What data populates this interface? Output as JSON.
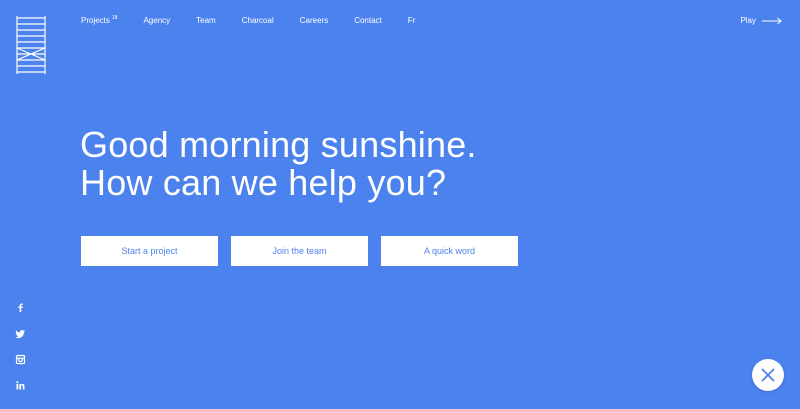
{
  "colors": {
    "background": "#4b82ee",
    "text": "#ffffff",
    "button_text": "#4b82ee",
    "button_bg": "#ffffff"
  },
  "logo": {
    "icon": "ladder-logo-icon"
  },
  "nav": {
    "items": [
      {
        "label": "Projects",
        "badge": "18"
      },
      {
        "label": "Agency"
      },
      {
        "label": "Team"
      },
      {
        "label": "Charcoal"
      },
      {
        "label": "Careers"
      },
      {
        "label": "Contact"
      },
      {
        "label": "Fr"
      }
    ]
  },
  "play": {
    "label": "Play",
    "icon": "arrow-right-icon"
  },
  "hero": {
    "line1": "Good morning sunshine.",
    "line2": "How can we help you?"
  },
  "ctas": [
    {
      "label": "Start a project"
    },
    {
      "label": "Join the team"
    },
    {
      "label": "A quick word"
    }
  ],
  "social": [
    {
      "icon": "facebook-icon"
    },
    {
      "icon": "twitter-icon"
    },
    {
      "icon": "instagram-icon"
    },
    {
      "icon": "linkedin-icon"
    }
  ],
  "close": {
    "icon": "close-icon"
  }
}
